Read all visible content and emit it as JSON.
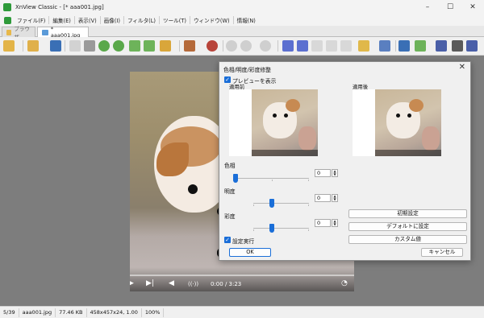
{
  "window": {
    "title": "XnView Classic - [* aaa001.jpg]",
    "minimize": "–",
    "maximize": "☐",
    "close": "✕"
  },
  "menu": [
    "ファイル(F)",
    "編集(E)",
    "表示(V)",
    "画像(I)",
    "フィルタ(L)",
    "ツール(T)",
    "ウィンドウ(W)",
    "情報(N)"
  ],
  "tabs": {
    "browser": "ブラウザ",
    "image": "* aaa001.jpg"
  },
  "player": {
    "time": "0:00 / 3:23",
    "next_icon": "▶|",
    "volume_icon": "◀",
    "cast_icon": "((·))",
    "speed_icon": "◔",
    "play_icon": "▶"
  },
  "status": {
    "index": "5/39",
    "filename": "aaa001.jpg",
    "filesize": "77.46 KB",
    "dimensions": "458x457x24, 1.00",
    "zoom": "100%"
  },
  "dialog": {
    "title": "色相/明度/彩度修整",
    "show_preview": "プレビューを表示",
    "before_label": "適用前",
    "after_label": "適用後",
    "hue_label": "色相",
    "brightness_label": "明度",
    "saturation_label": "彩度",
    "hue_value": "0",
    "brightness_value": "0",
    "saturation_value": "0",
    "apply_setting": "設定実行",
    "btn_initial": "初期設定",
    "btn_default": "デフォルトに設定",
    "btn_custom": "カスタム値",
    "btn_ok": "OK",
    "btn_cancel": "キャンセル",
    "check_mark": "✓"
  },
  "colors": {
    "accent": "#1a6ed8",
    "viewer_bg": "#7d7d7d",
    "dialog_bg": "#f0f0f0"
  }
}
